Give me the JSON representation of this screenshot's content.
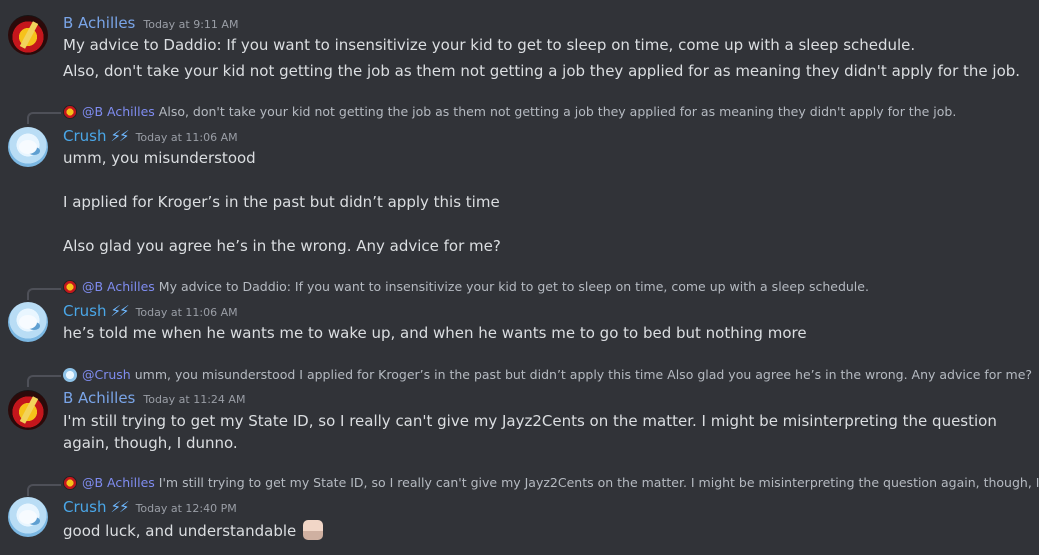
{
  "messages": [
    {
      "author": "B Achilles",
      "timestamp": "Today at 9:11 AM",
      "lines": [
        "My advice to Daddio: If you want to insensitivize your kid to get to sleep on time, come up with a sleep schedule.",
        "Also, don't take your kid not getting the job as them not getting a job they applied for as meaning they didn't apply for the job."
      ]
    },
    {
      "reply": {
        "mention": "@B Achilles",
        "text": "Also, don't take your kid not getting the job as them not getting a job they applied for as meaning they didn't apply for the job."
      },
      "author": "Crush",
      "timestamp": "Today at 11:06 AM",
      "lines": [
        "umm, you misunderstood",
        "I applied for Kroger’s in the past but didn’t apply this time",
        "Also glad you agree he’s in the wrong. Any advice for me?"
      ]
    },
    {
      "reply": {
        "mention": "@B Achilles",
        "text": "My advice to Daddio: If you want to insensitivize your kid to get to sleep on time, come up with a sleep schedule."
      },
      "author": "Crush",
      "timestamp": "Today at 11:06 AM",
      "lines": [
        "he’s told me when he wants me to wake up, and when he wants me to go to bed but nothing more"
      ]
    },
    {
      "reply": {
        "mention": "@Crush",
        "text": "umm, you misunderstood   I applied for Kroger’s in the past but didn’t apply this time  Also glad you agree he’s in the wrong. Any advice for me?"
      },
      "author": "B Achilles",
      "timestamp": "Today at 11:24 AM",
      "lines": [
        "I'm still trying to get my State ID, so I really can't give my Jayz2Cents on the matter. I might be misinterpreting the question again, though, I dunno."
      ]
    },
    {
      "reply": {
        "mention": "@B Achilles",
        "text": "I'm still trying to get my State ID, so I really can't give my Jayz2Cents on the matter. I might be misinterpreting the question again, though, I dunno."
      },
      "author": "Crush",
      "timestamp": "Today at 12:40 PM",
      "lines": [
        "good luck, and understandable"
      ]
    }
  ]
}
